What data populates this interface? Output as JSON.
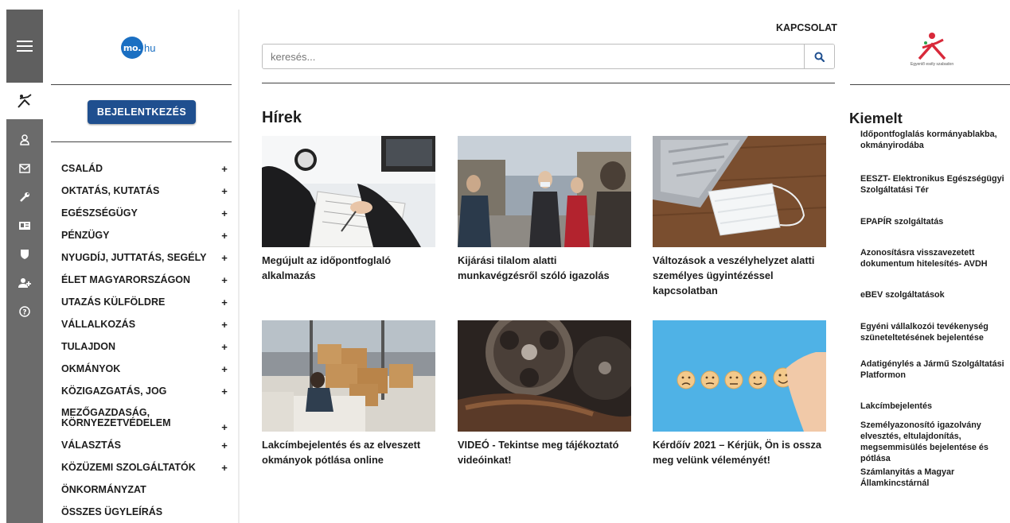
{
  "rail": {
    "menu_icon": "hamburger-icon",
    "icons": [
      "accessibility-icon",
      "user-icon",
      "mail-icon",
      "wrench-icon",
      "id-card-icon",
      "shield-icon",
      "add-user-icon",
      "help-icon"
    ]
  },
  "logo": {
    "prefix": "mo.",
    "suffix": "hu"
  },
  "sidebar": {
    "login_label": "BEJELENTKEZÉS",
    "categories": [
      {
        "label": "CSALÁD",
        "expand": "+"
      },
      {
        "label": "OKTATÁS, KUTATÁS",
        "expand": "+"
      },
      {
        "label": "EGÉSZSÉGÜGY",
        "expand": "+"
      },
      {
        "label": "PÉNZÜGY",
        "expand": "+"
      },
      {
        "label": "NYUGDÍJ, JUTTATÁS, SEGÉLY",
        "expand": "+"
      },
      {
        "label": "ÉLET MAGYARORSZÁGON",
        "expand": "+"
      },
      {
        "label": "UTAZÁS KÜLFÖLDRE",
        "expand": "+"
      },
      {
        "label": "VÁLLALKOZÁS",
        "expand": "+"
      },
      {
        "label": "TULAJDON",
        "expand": "+"
      },
      {
        "label": "OKMÁNYOK",
        "expand": "+"
      },
      {
        "label": "KÖZIGAZGATÁS, JOG",
        "expand": "+"
      },
      {
        "label": "MEZŐGAZDASÁG, KÖRNYEZETVÉDELEM",
        "expand": "+"
      },
      {
        "label": "VÁLASZTÁS",
        "expand": "+"
      },
      {
        "label": "KÖZÜZEMI SZOLGÁLTATÓK",
        "expand": "+"
      },
      {
        "label": "ÖNKORMÁNYZAT",
        "expand": ""
      },
      {
        "label": "ÖSSZES ÜGYLEÍRÁS",
        "expand": ""
      }
    ]
  },
  "header": {
    "contact_label": "KAPCSOLAT",
    "search_placeholder": "keresés...",
    "search_icon": "search-icon"
  },
  "brand": {
    "caption": "Egyenlő esély szabadon",
    "icon": "equal-opportunity-logo"
  },
  "news": {
    "title": "Hírek",
    "items": [
      {
        "caption": "Megújult az időpontfoglaló alkalmazás",
        "image": "calendar-writing-photo"
      },
      {
        "caption": "Kijárási tilalom alatti munkavégzésről szóló igazolás",
        "image": "masked-people-street-photo"
      },
      {
        "caption": "Változások a veszélyhelyzet alatti személyes ügyintézéssel kapcsolatban",
        "image": "face-mask-laptop-photo"
      },
      {
        "caption": "Lakcímbejelentés és az elveszett okmányok pótlása online",
        "image": "moving-boxes-photo"
      },
      {
        "caption": "VIDEÓ - Tekintse meg tájékoztató videóinkat!",
        "image": "film-reel-photo"
      },
      {
        "caption": "Kérdőív 2021 – Kérjük, Ön is ossza meg velünk véleményét!",
        "image": "smiley-rating-photo"
      }
    ]
  },
  "featured": {
    "title": "Kiemelt",
    "links": [
      "Időpontfoglalás kormányablakba, okmányirodába",
      "EESZT- Elektronikus Egészségügyi Szolgáltatási Tér",
      "EPAPÍR szolgáltatás",
      "Azonosításra visszavezetett dokumentum hitelesítés- AVDH",
      "eBEV szolgáltatások",
      "Egyéni vállalkozói tevékenység szüneteltetésének bejelentése",
      "Adatigénylés a Jármű Szolgáltatási Platformon",
      "Lakcímbejelentés",
      "Személyazonosító igazolvány elvesztés, eltulajdonítás, megsemmisülés bejelentése és pótlása",
      "Számlanyitás a Magyar Államkincstárnál"
    ]
  },
  "colors": {
    "rail": "#6b6b6b",
    "login_button": "#1f4f8f",
    "logo_blue": "#1a6fc2",
    "search_icon": "#1f4f8f",
    "brand_red": "#d8293a",
    "brand_green": "#2ea44f"
  }
}
